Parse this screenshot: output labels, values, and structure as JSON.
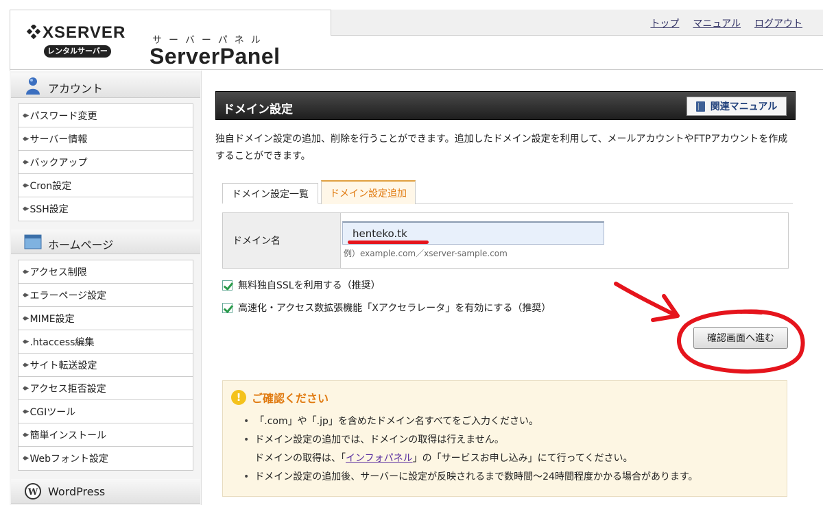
{
  "header": {
    "logo_brand": "XSERVER",
    "logo_sub": "レンタルサーバー",
    "panel_kana": "サーバーパネル",
    "panel_title": "ServerPanel",
    "links": {
      "top": "トップ",
      "manual": "マニュアル",
      "logout": "ログアウト"
    }
  },
  "sidebar": {
    "account": {
      "title": "アカウント",
      "items": [
        "パスワード変更",
        "サーバー情報",
        "バックアップ",
        "Cron設定",
        "SSH設定"
      ]
    },
    "homepage": {
      "title": "ホームページ",
      "items": [
        "アクセス制限",
        "エラーページ設定",
        "MIME設定",
        ".htaccess編集",
        "サイト転送設定",
        "アクセス拒否設定",
        "CGIツール",
        "簡単インストール",
        "Webフォント設定"
      ]
    },
    "wordpress": {
      "title": "WordPress"
    }
  },
  "main": {
    "title": "ドメイン設定",
    "manual_button": "関連マニュアル",
    "description": "独自ドメイン設定の追加、削除を行うことができます。追加したドメイン設定を利用して、メールアカウントやFTPアカウントを作成することができます。",
    "tabs": [
      {
        "label": "ドメイン設定一覧",
        "active": false
      },
      {
        "label": "ドメイン設定追加",
        "active": true
      }
    ],
    "form": {
      "domain_label": "ドメイン名",
      "domain_value": "henteko.tk",
      "domain_example": "例）example.com／xserver-sample.com"
    },
    "checkboxes": [
      {
        "label": "無料独自SSLを利用する（推奨）",
        "checked": true
      },
      {
        "label": "高速化・アクセス数拡張機能「Xアクセラレータ」を有効にする（推奨）",
        "checked": true
      }
    ],
    "confirm_button": "確認画面へ進む",
    "notice": {
      "title": "ご確認ください",
      "item1": "「.com」や「.jp」を含めたドメイン名すべてをご入力ください。",
      "item2": "ドメイン設定の追加では、ドメインの取得は行えません。",
      "item2_sub_prefix": "ドメインの取得は、「",
      "item2_sub_link": "インフォパネル",
      "item2_sub_suffix": "」の「サービスお申し込み」にて行ってください。",
      "item3": "ドメイン設定の追加後、サーバーに設定が反映されるまで数時間〜24時間程度かかる場合があります。"
    }
  },
  "colors": {
    "annotation_red": "#e5141c",
    "tab_active": "#e07a10",
    "notice_bg": "#fdf6e3"
  }
}
